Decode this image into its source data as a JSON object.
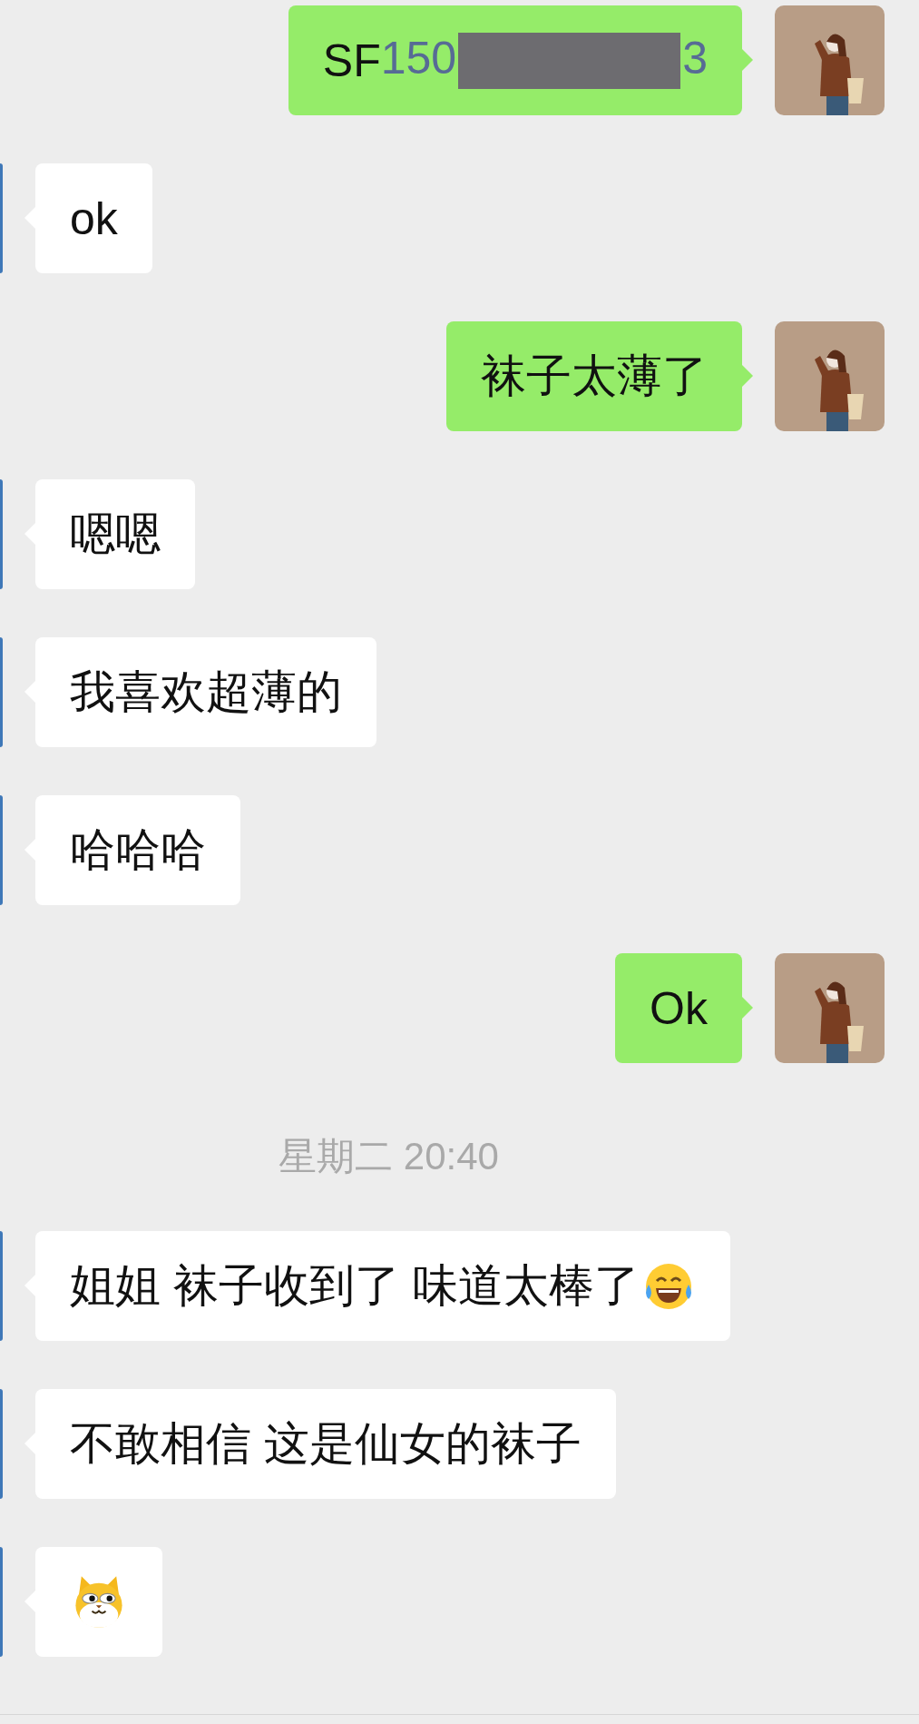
{
  "messages": [
    {
      "outgoing": true,
      "kind": "tracking",
      "prefix": "SF",
      "link_start": "150",
      "redacted": true,
      "link_end": "3"
    },
    {
      "outgoing": false,
      "kind": "text",
      "text": "ok"
    },
    {
      "outgoing": true,
      "kind": "text",
      "text": "袜子太薄了"
    },
    {
      "outgoing": false,
      "kind": "text",
      "text": "嗯嗯"
    },
    {
      "outgoing": false,
      "kind": "text",
      "text": "我喜欢超薄的"
    },
    {
      "outgoing": false,
      "kind": "text",
      "text": "哈哈哈"
    },
    {
      "outgoing": true,
      "kind": "text",
      "text": "Ok"
    },
    {
      "kind": "timestamp",
      "text": "星期二 20:40"
    },
    {
      "outgoing": false,
      "kind": "text",
      "text": "姐姐 袜子收到了 味道太棒了",
      "trailing_emoji": true
    },
    {
      "outgoing": false,
      "kind": "text",
      "text": "不敢相信 这是仙女的袜子"
    },
    {
      "outgoing": false,
      "kind": "sticker"
    }
  ]
}
